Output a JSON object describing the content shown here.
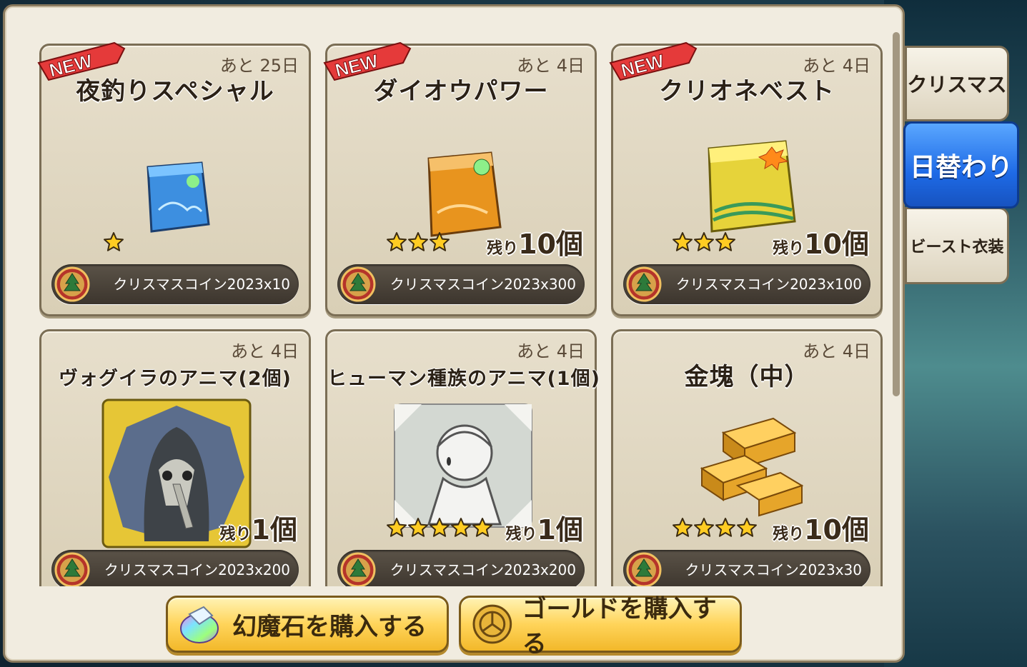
{
  "tabs": [
    {
      "label": "クリスマス",
      "active": false
    },
    {
      "label": "日替わり",
      "active": true
    },
    {
      "label": "ビースト衣装",
      "active": false
    }
  ],
  "items": [
    {
      "name": "夜釣りスペシャル",
      "remaining": "あと 25日",
      "new": true,
      "stars": 1,
      "stock_label": "",
      "stock_count": "",
      "price": "クリスマスコイン2023x10",
      "art": "blue-bag"
    },
    {
      "name": "ダイオウパワー",
      "remaining": "あと 4日",
      "new": true,
      "stars": 3,
      "stock_label": "残り",
      "stock_count": "10個",
      "price": "クリスマスコイン2023x300",
      "art": "orange-bag"
    },
    {
      "name": "クリオネベスト",
      "remaining": "あと 4日",
      "new": true,
      "stars": 3,
      "stock_label": "残り",
      "stock_count": "10個",
      "price": "クリスマスコイン2023x100",
      "art": "yellow-bag"
    },
    {
      "name": "ヴォグイラのアニマ(2個)",
      "remaining": "あと 4日",
      "new": false,
      "stars": 0,
      "stock_label": "残り",
      "stock_count": "1個",
      "price": "クリスマスコイン2023x200",
      "art": "plague-doctor"
    },
    {
      "name": "ヒューマン種族のアニマ(1個)",
      "remaining": "あと 4日",
      "new": false,
      "stars": 5,
      "stock_label": "残り",
      "stock_count": "1個",
      "price": "クリスマスコイン2023x200",
      "art": "human-silhouette"
    },
    {
      "name": "金塊（中）",
      "remaining": "あと 4日",
      "new": false,
      "stars": 4,
      "stock_label": "残り",
      "stock_count": "10個",
      "price": "クリスマスコイン2023x30",
      "art": "gold-bars"
    }
  ],
  "new_badge_text": "NEW",
  "buttons": {
    "buy_gems": "幻魔石を購入する",
    "buy_gold": "ゴールドを購入する"
  },
  "colors": {
    "panel": "#f1ece0",
    "price_bar": "#3c352d",
    "active_tab": "#1e6ae6",
    "button": "#ffd45a",
    "star": "#ffcc22"
  }
}
